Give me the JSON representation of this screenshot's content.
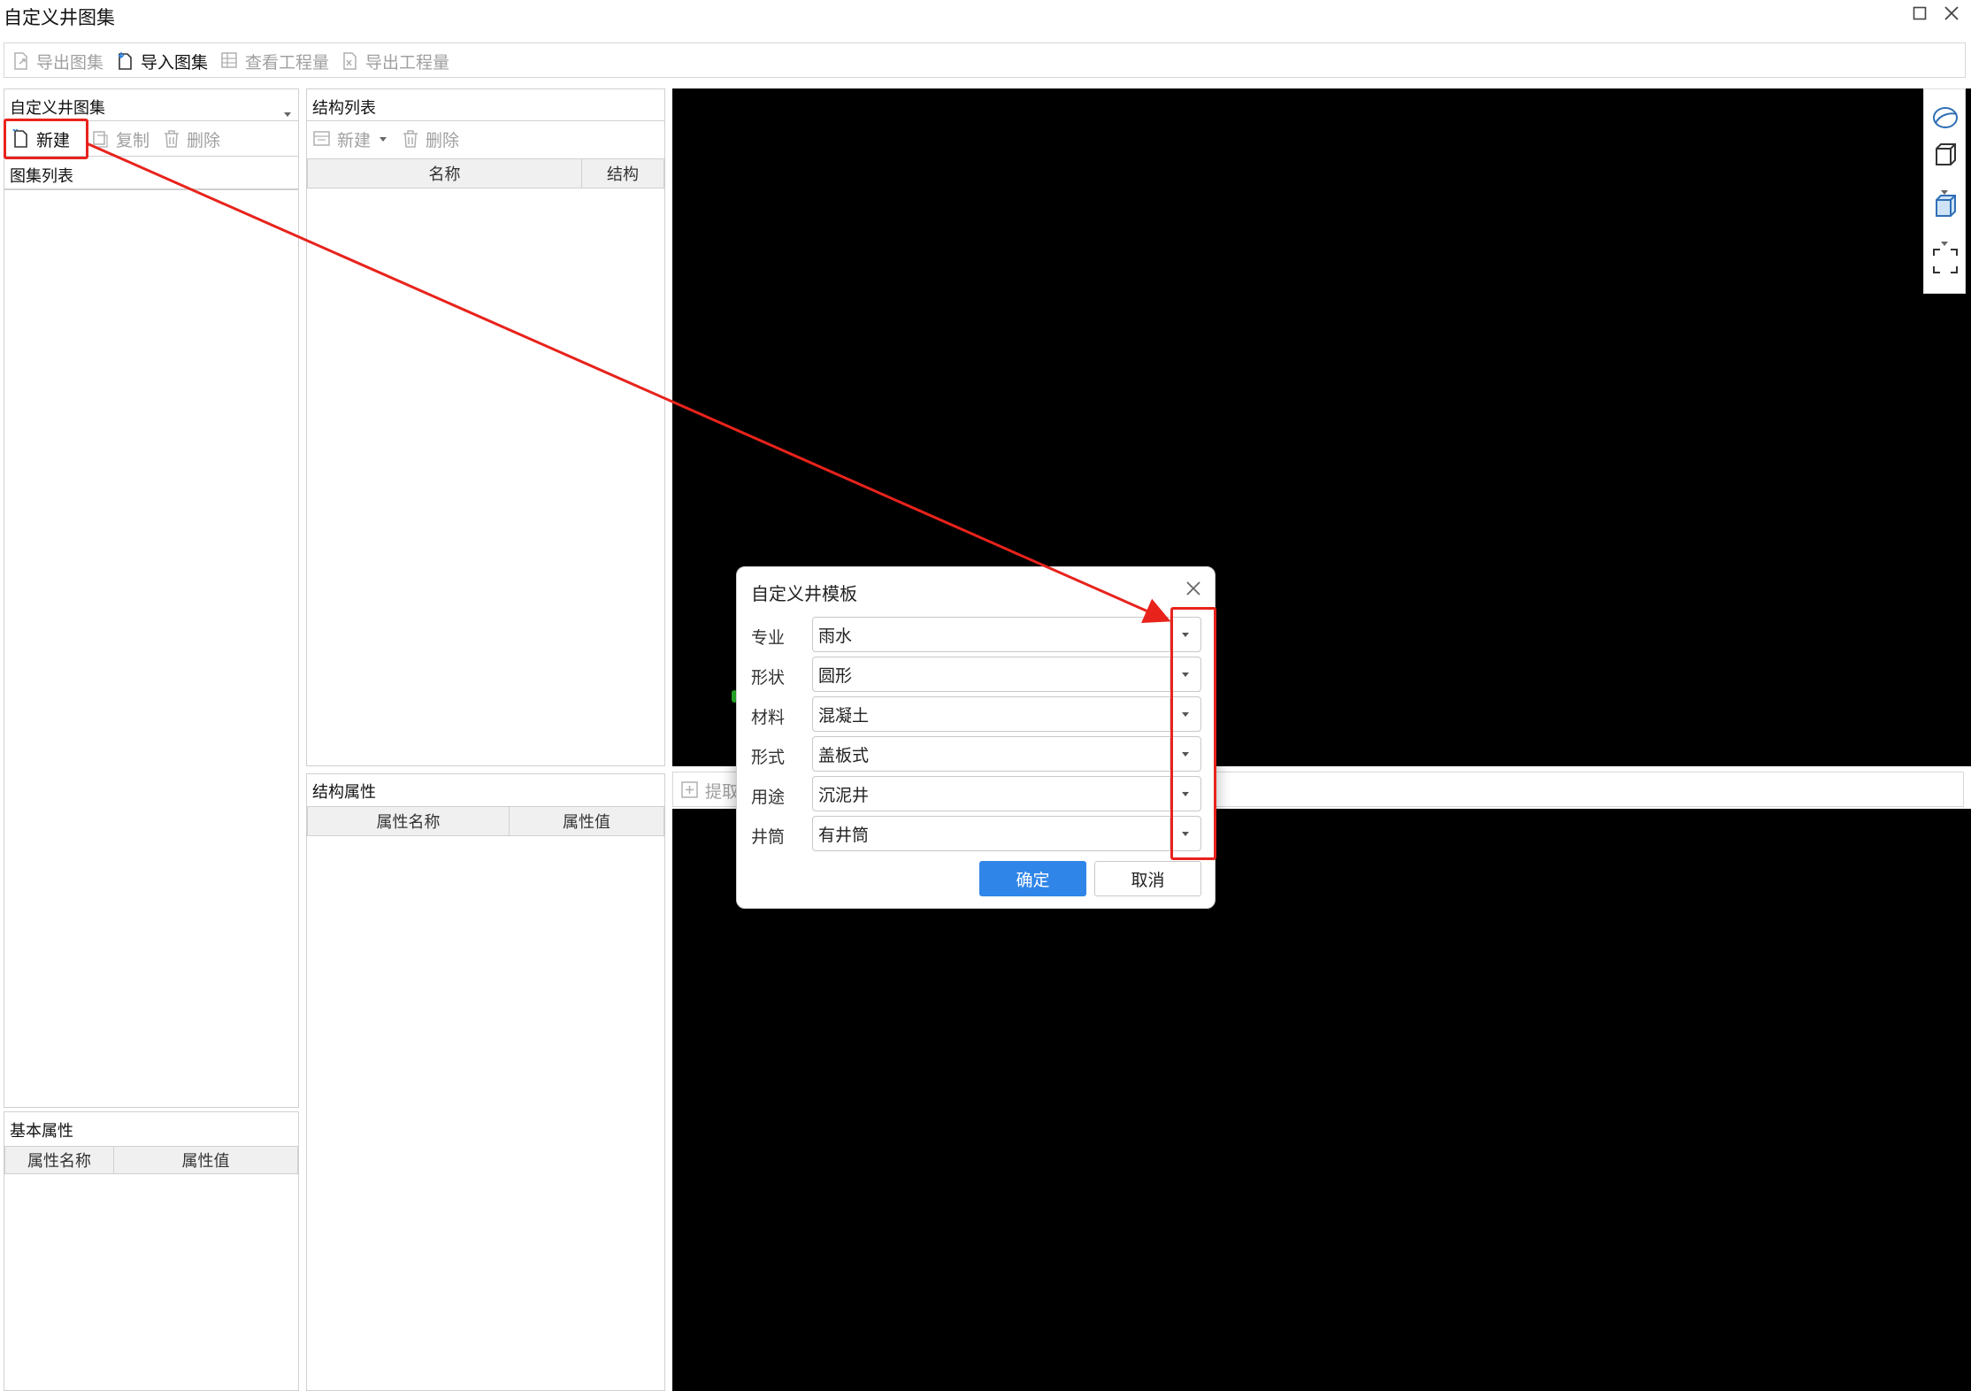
{
  "window": {
    "title": "自定义井图集"
  },
  "toolbar": {
    "export_atlas": "导出图集",
    "import_atlas": "导入图集",
    "view_quantities": "查看工程量",
    "export_quantities": "导出工程量"
  },
  "left_panel": {
    "selector_value": "自定义井图集",
    "new": "新建",
    "copy": "复制",
    "delete": "删除",
    "list_title": "图集列表"
  },
  "basic_props": {
    "title": "基本属性",
    "col_name": "属性名称",
    "col_value": "属性值"
  },
  "structure_list": {
    "title": "结构列表",
    "new": "新建",
    "delete": "删除",
    "col_name": "名称",
    "col_structure": "结构"
  },
  "structure_props": {
    "title": "结构属性",
    "col_name": "属性名称",
    "col_value": "属性值"
  },
  "lower_toolbar": {
    "extract": "提取"
  },
  "dialog": {
    "title": "自定义井模板",
    "fields": [
      {
        "label": "专业",
        "value": "雨水"
      },
      {
        "label": "形状",
        "value": "圆形"
      },
      {
        "label": "材料",
        "value": "混凝土"
      },
      {
        "label": "形式",
        "value": "盖板式"
      },
      {
        "label": "用途",
        "value": "沉泥井"
      },
      {
        "label": "井筒",
        "value": "有井筒"
      }
    ],
    "ok": "确定",
    "cancel": "取消"
  },
  "colors": {
    "annotation_red": "#e8231c",
    "primary_blue": "#2f86e8",
    "viewport": "#000000"
  }
}
